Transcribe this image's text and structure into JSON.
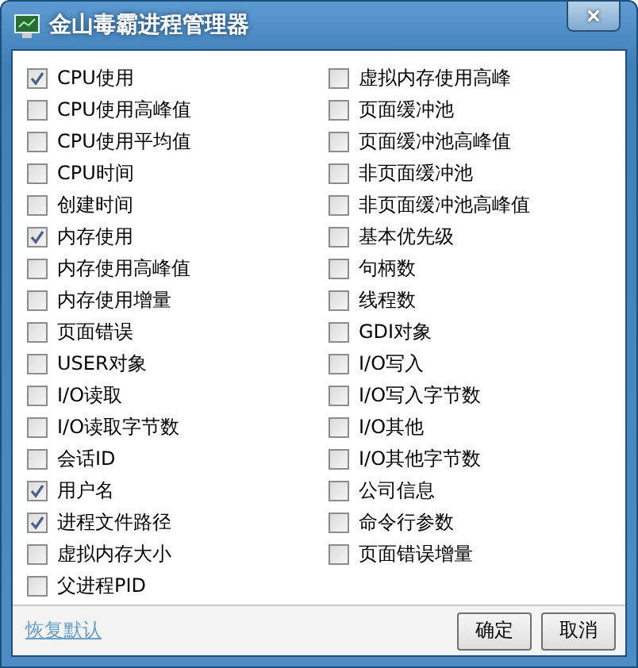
{
  "window": {
    "title": "金山毒霸进程管理器",
    "close_label": "×"
  },
  "columns": [
    [
      {
        "label": "CPU使用",
        "checked": true
      },
      {
        "label": "CPU使用高峰值",
        "checked": false
      },
      {
        "label": "CPU使用平均值",
        "checked": false
      },
      {
        "label": "CPU时间",
        "checked": false
      },
      {
        "label": "创建时间",
        "checked": false
      },
      {
        "label": "内存使用",
        "checked": true
      },
      {
        "label": "内存使用高峰值",
        "checked": false
      },
      {
        "label": "内存使用增量",
        "checked": false
      },
      {
        "label": "页面错误",
        "checked": false
      },
      {
        "label": "USER对象",
        "checked": false
      },
      {
        "label": "I/O读取",
        "checked": false
      },
      {
        "label": "I/O读取字节数",
        "checked": false
      },
      {
        "label": "会话ID",
        "checked": false
      },
      {
        "label": "用户名",
        "checked": true
      },
      {
        "label": "进程文件路径",
        "checked": true
      },
      {
        "label": "虚拟内存大小",
        "checked": false
      },
      {
        "label": "父进程PID",
        "checked": false
      }
    ],
    [
      {
        "label": "虚拟内存使用高峰",
        "checked": false
      },
      {
        "label": "页面缓冲池",
        "checked": false
      },
      {
        "label": "页面缓冲池高峰值",
        "checked": false
      },
      {
        "label": "非页面缓冲池",
        "checked": false
      },
      {
        "label": "非页面缓冲池高峰值",
        "checked": false
      },
      {
        "label": "基本优先级",
        "checked": false
      },
      {
        "label": "句柄数",
        "checked": false
      },
      {
        "label": "线程数",
        "checked": false
      },
      {
        "label": "GDI对象",
        "checked": false
      },
      {
        "label": "I/O写入",
        "checked": false
      },
      {
        "label": "I/O写入字节数",
        "checked": false
      },
      {
        "label": "I/O其他",
        "checked": false
      },
      {
        "label": "I/O其他字节数",
        "checked": false
      },
      {
        "label": "公司信息",
        "checked": false
      },
      {
        "label": "命令行参数",
        "checked": false
      },
      {
        "label": "页面错误增量",
        "checked": false
      }
    ]
  ],
  "footer": {
    "link": "恢复默认",
    "buttons": [
      "确定",
      "取消"
    ]
  }
}
